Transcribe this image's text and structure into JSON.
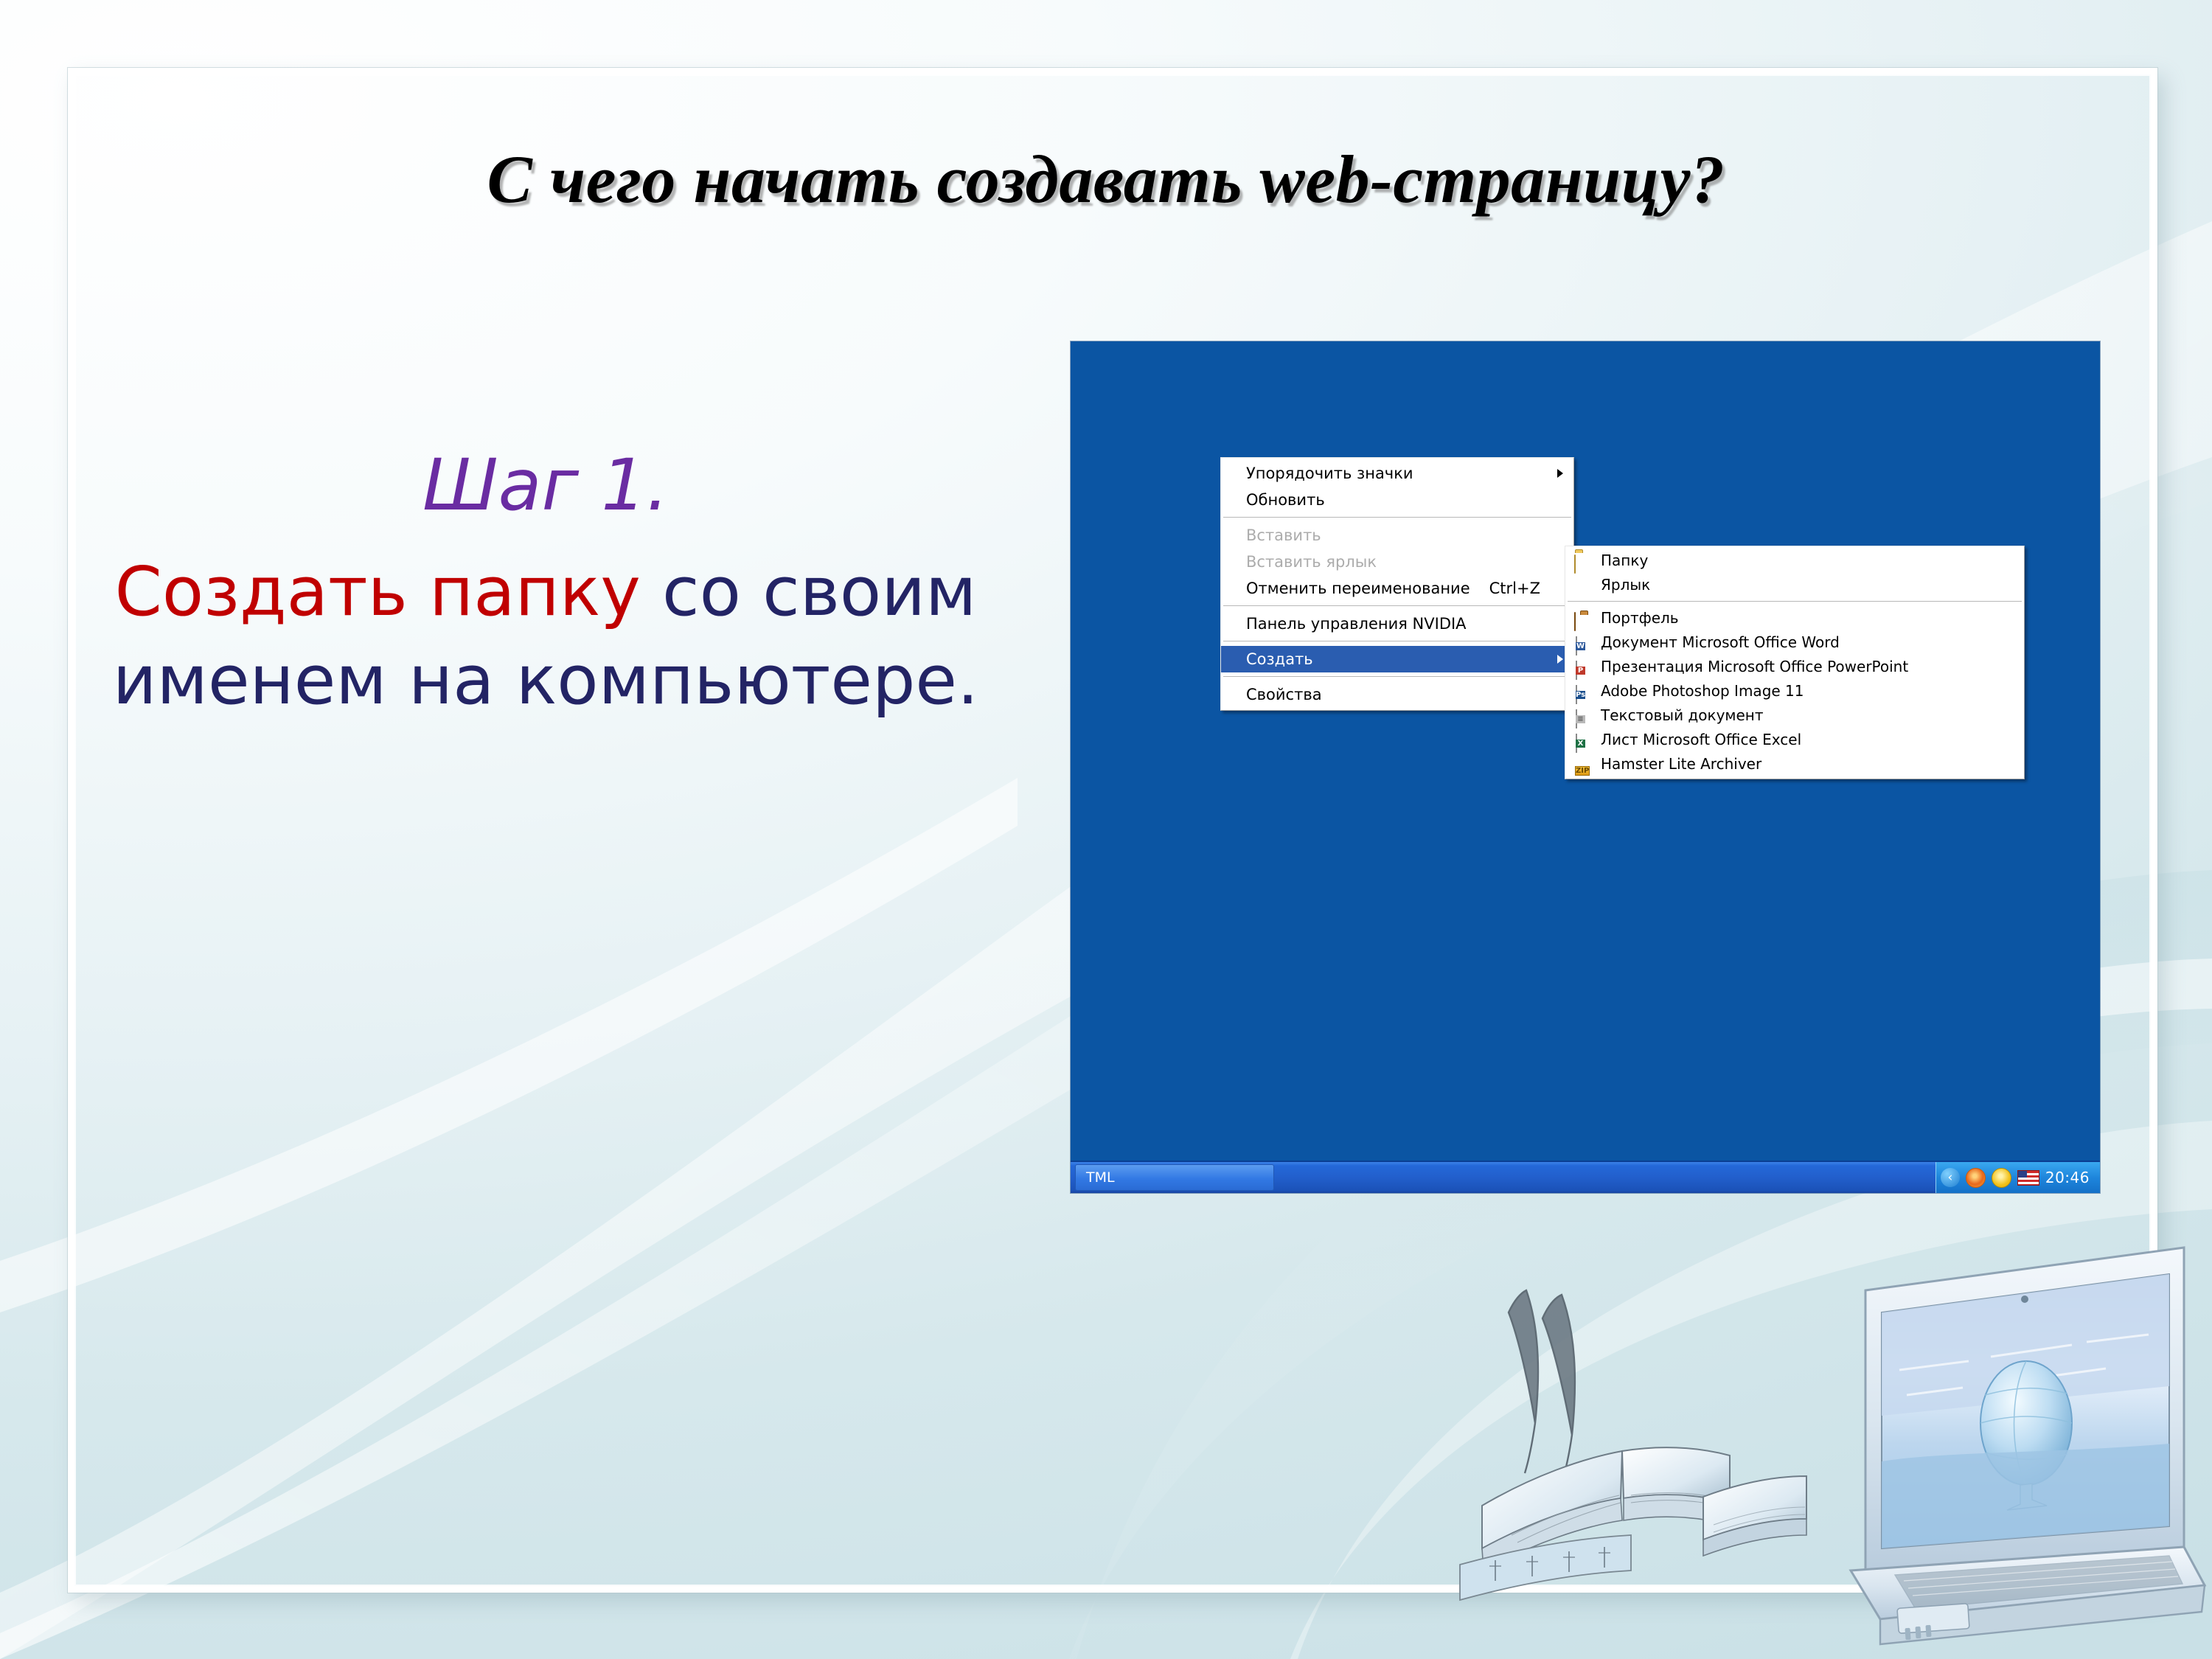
{
  "slide": {
    "title": "С чего начать создавать web-страницу?",
    "step_label": "Шаг 1.",
    "instruction_accent": "Создать папку",
    "instruction_rest": " со своим именем на компьютере.",
    "colors": {
      "title": "#000000",
      "step": "#6A2CA2",
      "accent": "#C00000",
      "body": "#232465",
      "desktop_blue": "#0B55A3",
      "menu_highlight": "#2A5DB0"
    }
  },
  "desktop": {
    "context_menu": {
      "items": [
        {
          "label": "Упорядочить значки",
          "submenu": true,
          "disabled": false,
          "selected": false,
          "accel": ""
        },
        {
          "label": "Обновить",
          "submenu": false,
          "disabled": false,
          "selected": false,
          "accel": ""
        },
        {
          "separator": true
        },
        {
          "label": "Вставить",
          "submenu": false,
          "disabled": true,
          "selected": false,
          "accel": ""
        },
        {
          "label": "Вставить ярлык",
          "submenu": false,
          "disabled": true,
          "selected": false,
          "accel": ""
        },
        {
          "label": "Отменить переименование",
          "submenu": false,
          "disabled": false,
          "selected": false,
          "accel": "Ctrl+Z"
        },
        {
          "separator": true
        },
        {
          "label": "Панель управления NVIDIA",
          "submenu": false,
          "disabled": false,
          "selected": false,
          "accel": ""
        },
        {
          "separator": true
        },
        {
          "label": "Создать",
          "submenu": true,
          "disabled": false,
          "selected": true,
          "accel": ""
        },
        {
          "separator": true
        },
        {
          "label": "Свойства",
          "submenu": false,
          "disabled": false,
          "selected": false,
          "accel": ""
        }
      ]
    },
    "submenu": {
      "items": [
        {
          "label": "Папку",
          "icon": "folder-icon",
          "underline": "П"
        },
        {
          "label": "Ярлык",
          "icon": "none",
          "underline": "Я"
        },
        {
          "separator": true
        },
        {
          "label": "Портфель",
          "icon": "briefcase-icon"
        },
        {
          "label": "Документ Microsoft Office Word",
          "icon": "word-document-icon"
        },
        {
          "label": "Презентация Microsoft Office PowerPoint",
          "icon": "powerpoint-document-icon"
        },
        {
          "label": "Adobe Photoshop Image 11",
          "icon": "photoshop-document-icon"
        },
        {
          "label": "Текстовый документ",
          "icon": "text-document-icon"
        },
        {
          "label": "Лист Microsoft Office Excel",
          "icon": "excel-document-icon"
        },
        {
          "label": "Hamster Lite Archiver",
          "icon": "zip-archive-icon"
        }
      ]
    },
    "taskbar": {
      "button_label": "TML",
      "tray_expander": "‹",
      "tray_icons": [
        "orange-status-icon",
        "yellow-status-icon",
        "language-flag-icon"
      ],
      "clock": "20:46"
    }
  }
}
